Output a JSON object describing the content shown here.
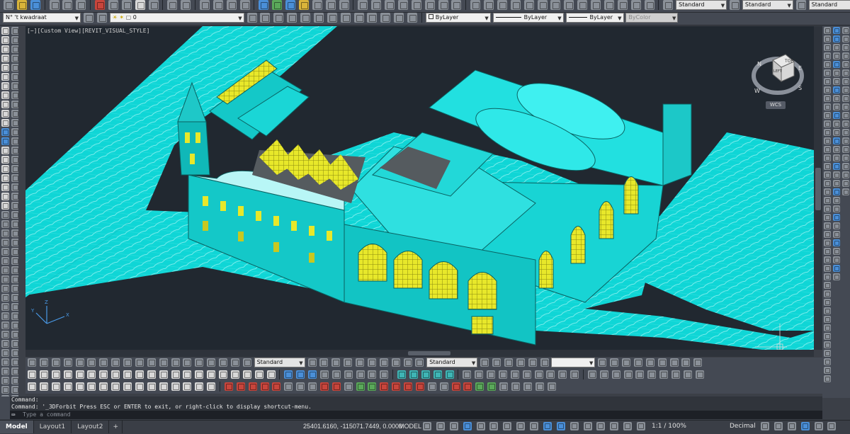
{
  "toolbar_top": {
    "layer_state": "N° 't kwadraat",
    "layer_name": "0",
    "color": "ByLayer",
    "linetype": "ByLayer",
    "lineweight": "ByLayer",
    "plotstyle": "ByColor",
    "text_style": "Standard",
    "dim_style": "Standard",
    "table_style": "Standard",
    "mleader_style": "Standard"
  },
  "viewport": {
    "label": "[−][Custom View][REVIT_VISUAL_STYLE]",
    "viewcube": {
      "top": "TOP",
      "left": "LEFT",
      "north": "N",
      "east": "E",
      "south": "S",
      "west": "W"
    },
    "wcs": "WCS",
    "ucs": {
      "x": "X",
      "y": "Y",
      "z": "Z"
    },
    "colors": {
      "background": "#212830",
      "model": "#00e5e5",
      "highlight": "#e8e82a",
      "roof": "#6b6b6b"
    }
  },
  "toolbar_bottom": {
    "style_1": "Standard",
    "style_2": "Standard",
    "blank_combo": ""
  },
  "command": {
    "history_1": "Command:",
    "history_2": "Command: '_3DForbit Press ESC or ENTER to exit, or right-click to display shortcut-menu.",
    "placeholder": "Type a command",
    "prompt_icon": "command-prompt-icon"
  },
  "status_bar": {
    "tabs": [
      "Model",
      "Layout1",
      "Layout2"
    ],
    "add_tab": "+",
    "coordinates": "25401.6160, -115071.7449, 0.0000",
    "space": "MODEL",
    "scale": "1:1 / 100%",
    "units": "Decimal"
  }
}
